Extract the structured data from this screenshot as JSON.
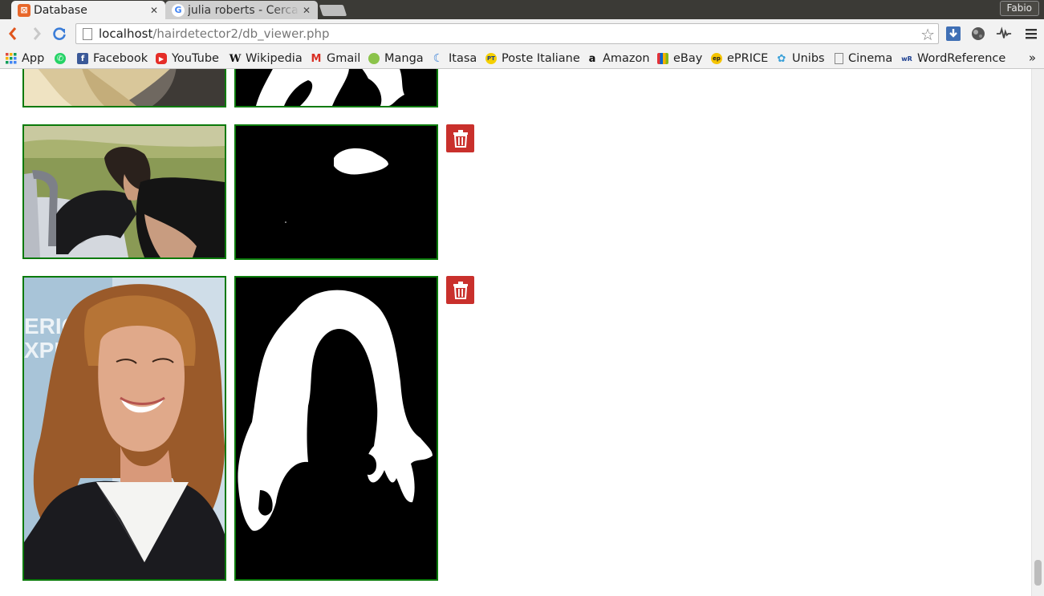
{
  "browser": {
    "tabs": [
      {
        "title": "Database",
        "active": true,
        "favicon": "xampp-icon"
      },
      {
        "title": "julia roberts - Cerca con Google",
        "active": false,
        "favicon": "google-icon"
      }
    ],
    "user": "Fabio",
    "url": {
      "host": "localhost",
      "path": "/hairdetector2/db_viewer.php"
    },
    "bookmarks": [
      {
        "label": "App",
        "icon": "apps-grid-icon"
      },
      {
        "label": "Facebook",
        "icon": "facebook-icon"
      },
      {
        "label": "YouTube",
        "icon": "youtube-icon"
      },
      {
        "label": "Wikipedia",
        "icon": "wikipedia-icon"
      },
      {
        "label": "Gmail",
        "icon": "gmail-icon"
      },
      {
        "label": "Manga",
        "icon": "manga-icon"
      },
      {
        "label": "Itasa",
        "icon": "itasa-icon"
      },
      {
        "label": "Poste Italiane",
        "icon": "poste-icon"
      },
      {
        "label": "Amazon",
        "icon": "amazon-icon"
      },
      {
        "label": "eBay",
        "icon": "ebay-icon"
      },
      {
        "label": "ePRICE",
        "icon": "eprice-icon"
      },
      {
        "label": "Unibs",
        "icon": "unibs-icon"
      },
      {
        "label": "Cinema",
        "icon": "page-icon"
      },
      {
        "label": "WordReference",
        "icon": "wordreference-icon"
      }
    ],
    "more_bookmarks": "»"
  },
  "rows": [
    {
      "photo": "photo-blonde-hair",
      "mask": "hair-mask",
      "has_delete": false
    },
    {
      "photo": "photo-man-with-dog-in-car",
      "mask": "hair-mask",
      "has_delete": true
    },
    {
      "photo": "photo-julia-roberts",
      "mask": "hair-mask",
      "has_delete": true
    }
  ],
  "colors": {
    "frame": "#0a7a0a",
    "delete_button": "#c9302c"
  }
}
